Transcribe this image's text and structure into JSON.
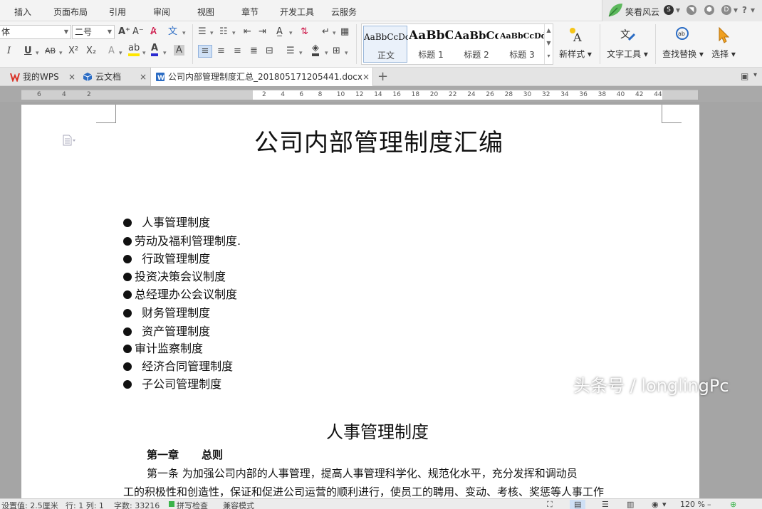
{
  "menu": [
    "插入",
    "页面布局",
    "引用",
    "审阅",
    "视图",
    "章节",
    "开发工具",
    "云服务"
  ],
  "user": {
    "name": "笑看风云"
  },
  "ribbon": {
    "font_name": "体",
    "font_size": "二号",
    "styles": [
      {
        "sample": "AaBbCcDc",
        "name": "正文"
      },
      {
        "sample": "AaBbC",
        "name": "标题 1"
      },
      {
        "sample": "AaBbCc",
        "name": "标题 2"
      },
      {
        "sample": "AaBbCcDd",
        "name": "标题 3"
      }
    ],
    "new_style": "新样式",
    "text_tools": "文字工具",
    "find_replace": "查找替换",
    "select": "选择"
  },
  "tabs": [
    {
      "label": "我的WPS"
    },
    {
      "label": "云文档"
    },
    {
      "label": "公司内部管理制度汇总_201805171205441.docx"
    }
  ],
  "ruler": {
    "left_numbers": [
      "6",
      "4",
      "2"
    ],
    "right_numbers": [
      "2",
      "4",
      "6",
      "8",
      "10",
      "12",
      "14",
      "16",
      "18",
      "20",
      "22",
      "24",
      "26",
      "28",
      "30",
      "32",
      "34",
      "36",
      "38",
      "40",
      "42",
      "44"
    ]
  },
  "document": {
    "title": "公司内部管理制度汇编",
    "toc": [
      {
        "text": "人事管理制度"
      },
      {
        "text": "劳动及福利管理制度."
      },
      {
        "text": "行政管理制度"
      },
      {
        "text": "投资决策会议制度"
      },
      {
        "text": "总经理办公会议制度"
      },
      {
        "text": "财务管理制度"
      },
      {
        "text": "资产管理制度"
      },
      {
        "text": "审计监察制度"
      },
      {
        "text": "经济合同管理制度"
      },
      {
        "text": "子公司管理制度"
      }
    ],
    "section_title": "人事管理制度",
    "chapter_num": "第一章",
    "chapter_title": "总则",
    "para1_line1": "第一条 为加强公司内部的人事管理，提高人事管理科学化、规范化水平，充分发挥和调动员",
    "para1_line2": "工的积极性和创造性，保证和促进公司运营的顺利进行，使员工的聘用、变动、考核、奖惩等人事工作"
  },
  "watermark": "头条号 / longlingPc",
  "status": {
    "setting": "设置值: 2.5厘米",
    "row_col": "行: 1  列: 1",
    "word_count": "字数: 33216",
    "spell": "拼写检查",
    "mode": "兼容模式",
    "zoom": "120 %"
  },
  "colors": {
    "accent_blue": "#2b6cc4",
    "wps_red": "#d93025",
    "active_tab": "#ffffff",
    "highlight_yellow": "#ffe600"
  }
}
